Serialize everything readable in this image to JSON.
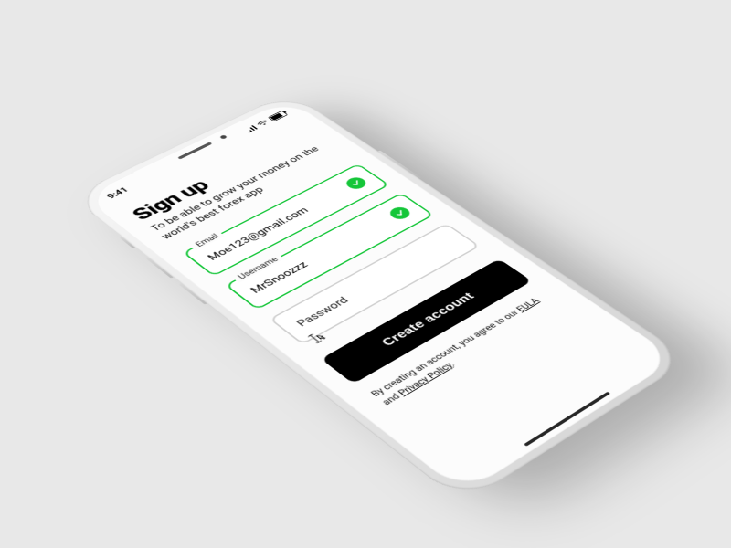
{
  "status": {
    "time": "9:41"
  },
  "header": {
    "title": "Sign up",
    "subtitle": "To be able to grow your money on the world's best forex app"
  },
  "fields": {
    "email": {
      "label": "Email",
      "value": "Moe123@gmail.com",
      "valid": true
    },
    "username": {
      "label": "Username",
      "value": "MrSnoozzz",
      "valid": true
    },
    "password": {
      "placeholder": "Password",
      "value": ""
    }
  },
  "cta": {
    "label": "Create account"
  },
  "legal": {
    "prefix": "By creating an account, you agree to our ",
    "eula": "EULA",
    "and": " and ",
    "privacy": "Privacy Policy",
    "suffix": "."
  }
}
